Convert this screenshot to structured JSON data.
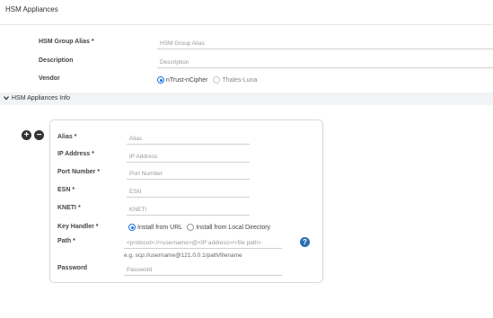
{
  "header": {
    "title": "HSM Appliances"
  },
  "group": {
    "alias_label": "HSM Group Alias *",
    "alias_placeholder": "HSM Group Alias",
    "description_label": "Description",
    "description_placeholder": "Description",
    "vendor_label": "Vendor",
    "vendor_options": [
      {
        "label": "nTrust-nCipher",
        "selected": true
      },
      {
        "label": "Thales-Luna",
        "selected": false
      }
    ]
  },
  "section": {
    "title": "HSM Appliances Info",
    "chevron_icon": "chevron-down-icon"
  },
  "controls": {
    "add_icon": "plus-circle-icon",
    "add_glyph": "+",
    "remove_icon": "minus-circle-icon",
    "remove_glyph": "−"
  },
  "appliance": {
    "alias_label": "Alias *",
    "alias_placeholder": "Alias",
    "ip_label": "IP Address *",
    "ip_placeholder": "IP Address",
    "port_label": "Port Number *",
    "port_placeholder": "Port Number",
    "esn_label": "ESN *",
    "esn_placeholder": "ESN",
    "kneti_label": "KNETI *",
    "kneti_placeholder": "KNETI",
    "key_handler_label": "Key Handler *",
    "key_handler_options": [
      {
        "label": "Install from URL",
        "selected": true
      },
      {
        "label": "Install from Local Directory",
        "selected": false
      }
    ],
    "path_label": "Path *",
    "path_placeholder": "<protocol>://<username>@<IP address>/<file path>",
    "path_hint": "e.g. scp://username@121.0.0.1/path/filename",
    "help_glyph": "?",
    "password_label": "Password",
    "password_placeholder": "Password"
  },
  "colors": {
    "accent": "#1a73e8",
    "help": "#2a6fb3",
    "section_bg": "#f2f3f5"
  }
}
